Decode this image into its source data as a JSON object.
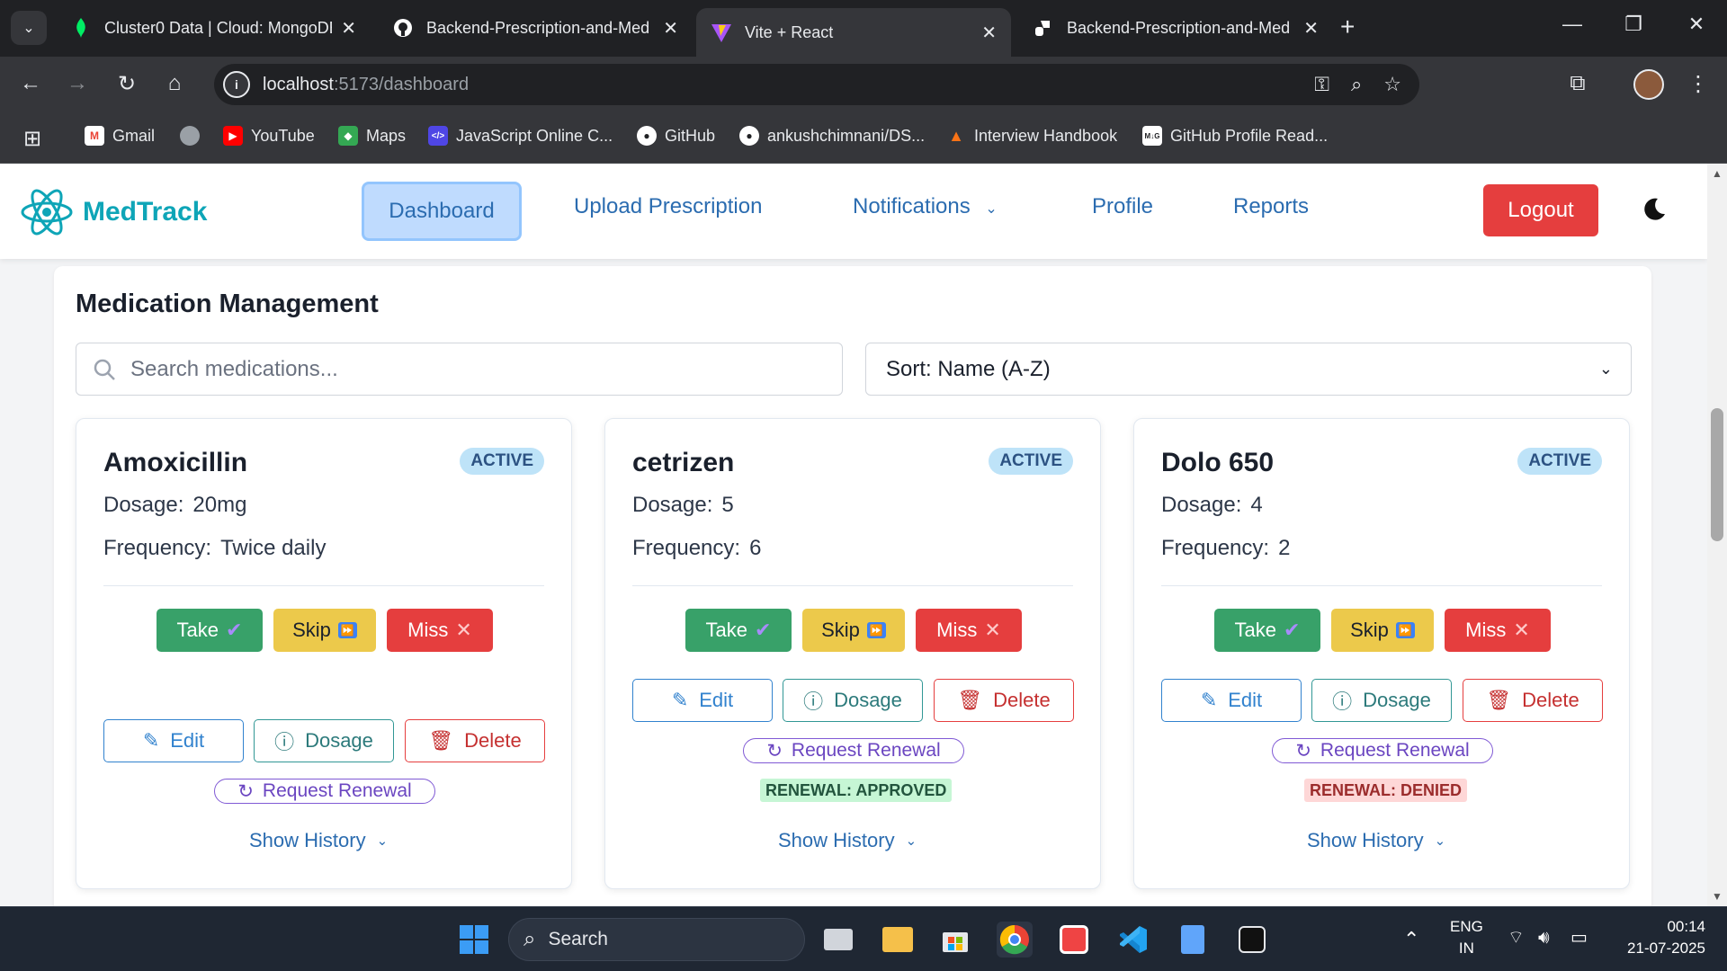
{
  "browser": {
    "tabs": [
      {
        "title": "Cluster0 Data | Cloud: MongoDB",
        "icon": "mongodb-leaf-icon"
      },
      {
        "title": "Backend-Prescription-and-Med",
        "icon": "github-icon"
      },
      {
        "title": "Vite + React",
        "icon": "vite-icon",
        "active": true
      },
      {
        "title": "Backend-Prescription-and-Med",
        "icon": "render-icon"
      }
    ],
    "url_host": "localhost",
    "url_path": ":5173/dashboard",
    "bookmarks": [
      {
        "label": "Gmail",
        "icon": "gmail-icon"
      },
      {
        "label": "",
        "icon": "globe-icon"
      },
      {
        "label": "YouTube",
        "icon": "youtube-icon"
      },
      {
        "label": "Maps",
        "icon": "maps-icon"
      },
      {
        "label": "JavaScript Online C...",
        "icon": "code-icon"
      },
      {
        "label": "GitHub",
        "icon": "github-icon"
      },
      {
        "label": "ankushchimnani/DS...",
        "icon": "github-icon"
      },
      {
        "label": "Interview Handbook",
        "icon": "interview-icon"
      },
      {
        "label": "GitHub Profile Read...",
        "icon": "readme-icon"
      }
    ]
  },
  "app": {
    "logo": "MedTrack",
    "nav": {
      "dashboard": "Dashboard",
      "upload": "Upload Prescription",
      "notifications": "Notifications",
      "profile": "Profile",
      "reports": "Reports",
      "logout": "Logout"
    },
    "heading": "Medication Management",
    "search_placeholder": "Search medications...",
    "sort_label": "Sort: Name (A-Z)",
    "labels": {
      "dosage": "Dosage:",
      "frequency": "Frequency:",
      "take": "Take",
      "skip": "Skip",
      "miss": "Miss",
      "edit": "Edit",
      "dosage_btn": "Dosage",
      "delete": "Delete",
      "renew": "Request Renewal",
      "history": "Show History"
    },
    "medications": [
      {
        "name": "Amoxicillin",
        "status": "ACTIVE",
        "dosage": "20mg",
        "frequency": "Twice daily",
        "renewal": ""
      },
      {
        "name": "cetrizen",
        "status": "ACTIVE",
        "dosage": "5",
        "frequency": "6",
        "renewal": "RENEWAL: APPROVED"
      },
      {
        "name": "Dolo 650",
        "status": "ACTIVE",
        "dosage": "4",
        "frequency": "2",
        "renewal": "RENEWAL: DENIED"
      }
    ]
  },
  "taskbar": {
    "search": "Search",
    "lang_top": "ENG",
    "lang_bottom": "IN",
    "time": "00:14",
    "date": "21-07-2025"
  },
  "colors": {
    "brand": "#0ea5b7",
    "link": "#2b6cb0",
    "logout": "#e53e3e",
    "take": "#38a169",
    "skip": "#ecc94b",
    "miss": "#e53e3e"
  }
}
